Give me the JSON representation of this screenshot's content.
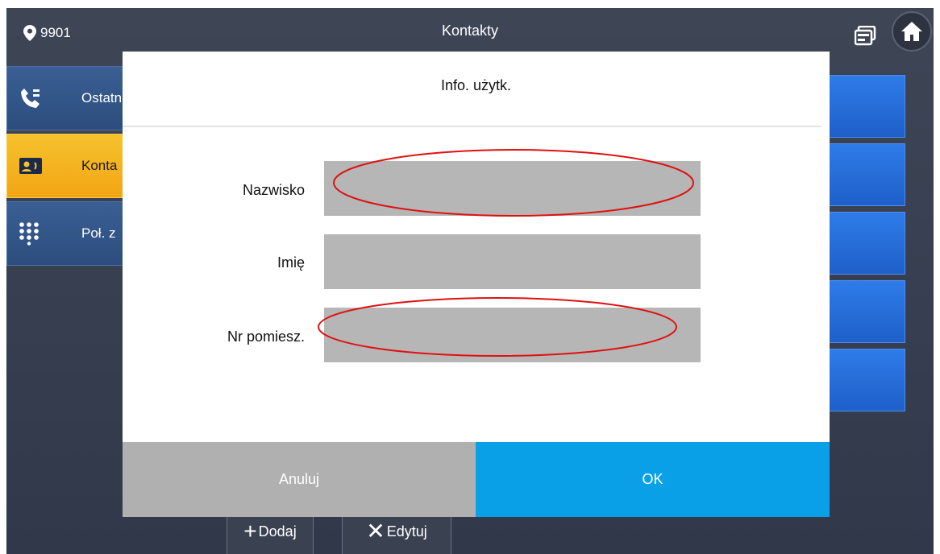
{
  "topbar": {
    "location": "9901",
    "title": "Kontakty",
    "icons": [
      "location-pin-icon",
      "messages-icon",
      "home-icon"
    ]
  },
  "sidebar": {
    "items": [
      {
        "label": "Ostatn",
        "icon": "call-log-icon",
        "active": false
      },
      {
        "label": "Konta",
        "icon": "contacts-card-icon",
        "active": true
      },
      {
        "label": "Poł. z",
        "icon": "dialpad-icon",
        "active": false
      }
    ]
  },
  "bottom": {
    "add_label": "Dodaj",
    "edit_label": "Edytuj"
  },
  "dialog": {
    "title": "Info. użytk.",
    "fields": [
      {
        "label": "Nazwisko",
        "value": "",
        "highlighted": true
      },
      {
        "label": "Imię",
        "value": "",
        "highlighted": false
      },
      {
        "label": "Nr pomiesz.",
        "value": "",
        "highlighted": true
      }
    ],
    "cancel_label": "Anuluj",
    "ok_label": "OK"
  },
  "colors": {
    "accent_active": "#f5c22d",
    "nav_blue": "#2c4d7d",
    "ok_blue": "#0aa0e8",
    "cancel_gray": "#b0b0b0",
    "field_gray": "#b6b6b6",
    "annotation_red": "#e01010"
  }
}
